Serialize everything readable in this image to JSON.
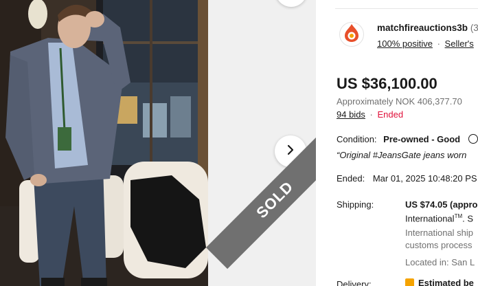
{
  "gallery": {
    "next_icon": "chevron-right-icon",
    "sold_label": "SOLD"
  },
  "seller": {
    "name": "matchfireauctions3b",
    "count": "(3",
    "positive": "100% positive",
    "separator": "·",
    "other_link": "Seller's"
  },
  "listing": {
    "price": "US $36,100.00",
    "approx": "Approximately NOK 406,377.70",
    "bids": "94 bids",
    "bids_sep": "·",
    "status": "Ended",
    "condition_label": "Condition:",
    "condition_value": "Pre-owned - Good",
    "description": "“Original #JeansGate jeans worn",
    "ended_label": "Ended:",
    "ended_value": "Mar 01, 2025 10:48:20 PS"
  },
  "shipping": {
    "label": "Shipping:",
    "cost": "US $74.05 (appro",
    "service": "International",
    "service_mark": "TM",
    "service_tail": ". S",
    "note1": "International ship",
    "note2": "customs process",
    "located": "Located in: San L"
  },
  "delivery": {
    "label": "Delivery:",
    "value": "Estimated be"
  },
  "colors": {
    "ended_red": "#e0103a",
    "ribbon_gray": "#707070",
    "logo_orange": "#e8502b"
  }
}
